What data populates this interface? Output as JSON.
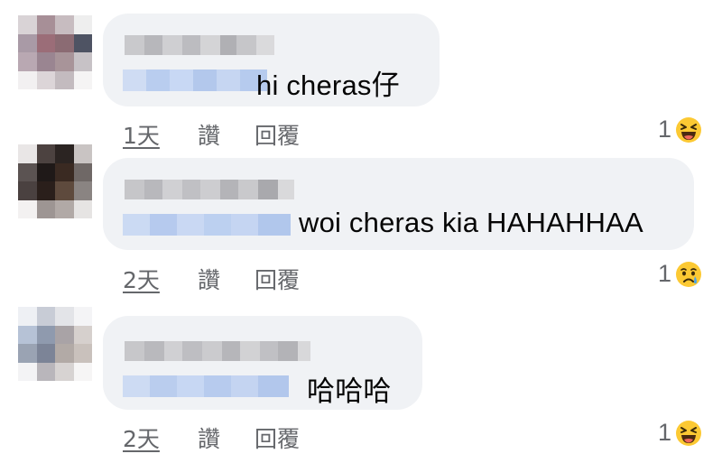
{
  "comments": [
    {
      "text": "hi cheras仔",
      "time": "1天",
      "like_label": "讚",
      "reply_label": "回覆",
      "reaction_count": "1",
      "reaction_icon": "laughing-emoji-icon"
    },
    {
      "text": "woi cheras kia HAHAHHAA",
      "time": "2天",
      "like_label": "讚",
      "reply_label": "回覆",
      "reaction_count": "1",
      "reaction_icon": "sad-tear-emoji-icon"
    },
    {
      "text": "哈哈哈",
      "time": "2天",
      "like_label": "讚",
      "reply_label": "回覆",
      "reaction_count": "1",
      "reaction_icon": "laughing-emoji-icon"
    }
  ],
  "colors": {
    "bubble": "#f0f2f5",
    "meta_text": "#65676b",
    "mention_blue": "#b8cdf0",
    "emoji_yellow": "#fcc933"
  }
}
